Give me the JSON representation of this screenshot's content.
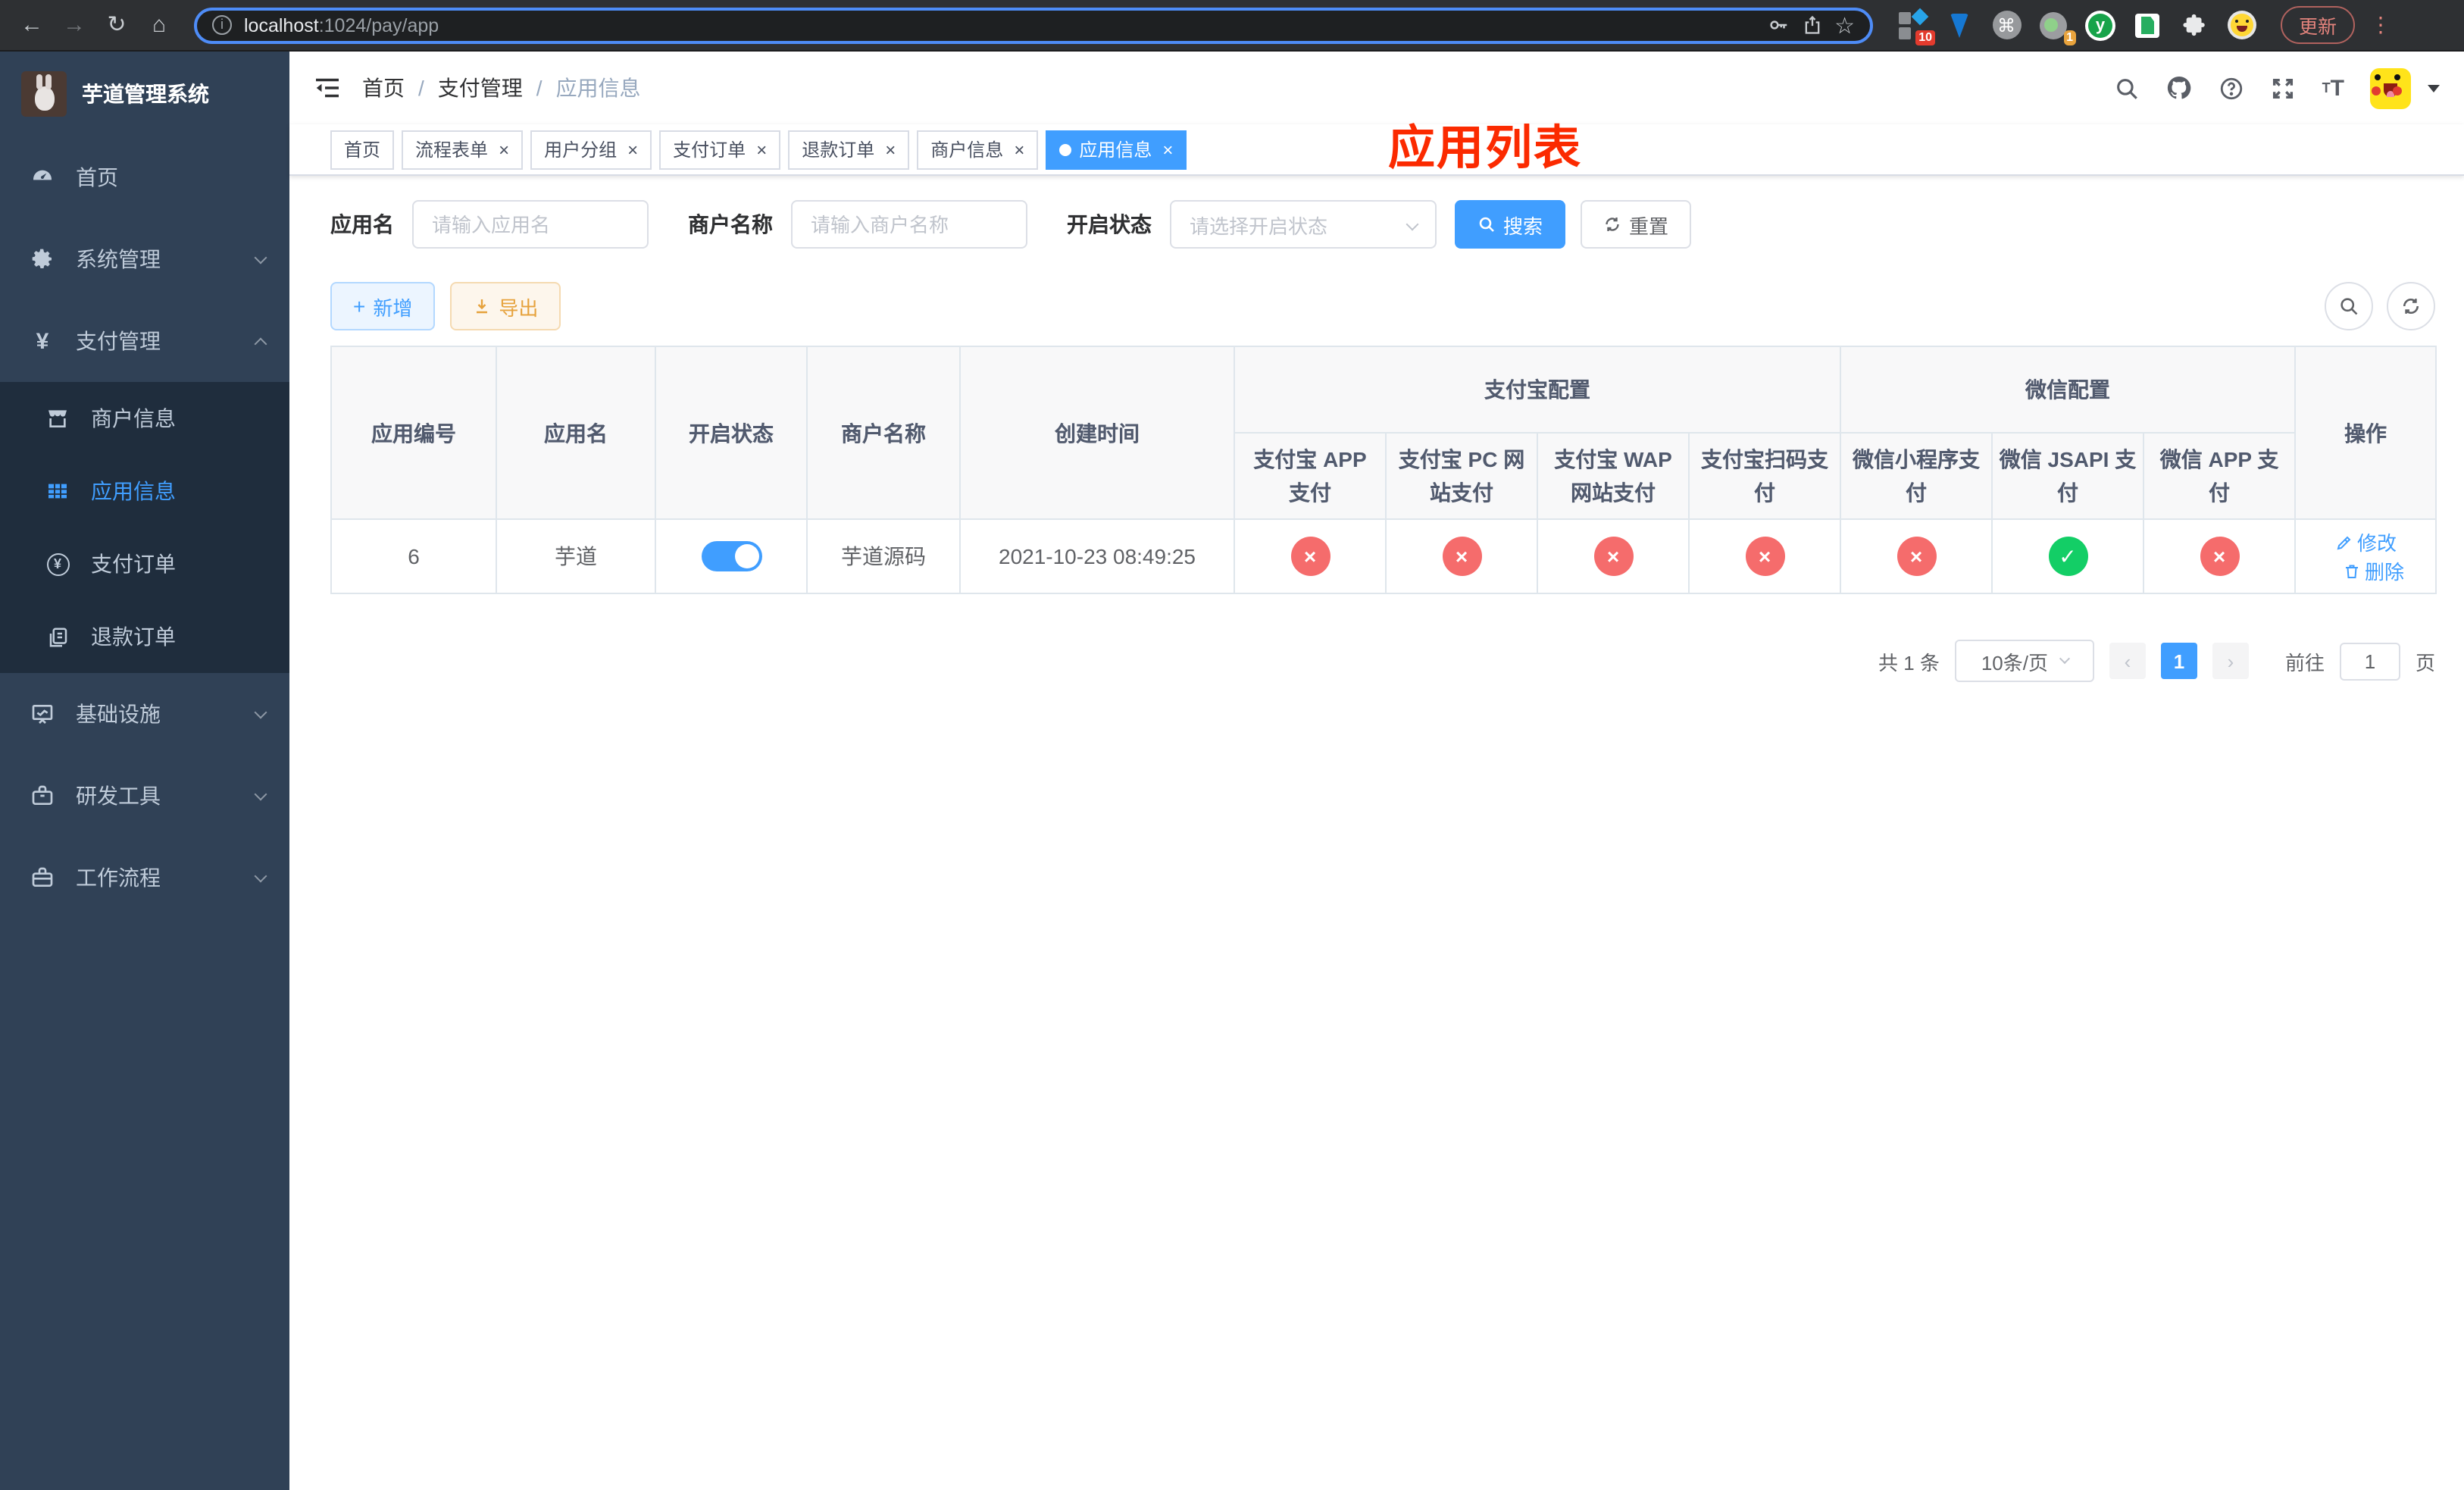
{
  "browser": {
    "url_host": "localhost",
    "url_rest": ":1024/pay/app",
    "update_label": "更新",
    "ext_badge_blocks": "10",
    "ext_badge_ring": "1",
    "ext_y_label": "y",
    "cmd_glyph": "⌘"
  },
  "sidebar": {
    "title": "芋道管理系统",
    "items": [
      {
        "label": "首页"
      },
      {
        "label": "系统管理"
      },
      {
        "label": "支付管理"
      },
      {
        "label": "商户信息"
      },
      {
        "label": "应用信息"
      },
      {
        "label": "支付订单"
      },
      {
        "label": "退款订单"
      },
      {
        "label": "基础设施"
      },
      {
        "label": "研发工具"
      },
      {
        "label": "工作流程"
      }
    ]
  },
  "header": {
    "breadcrumb": [
      "首页",
      "支付管理",
      "应用信息"
    ],
    "annotation": "应用列表"
  },
  "tabs": [
    {
      "label": "首页"
    },
    {
      "label": "流程表单"
    },
    {
      "label": "用户分组"
    },
    {
      "label": "支付订单"
    },
    {
      "label": "退款订单"
    },
    {
      "label": "商户信息"
    },
    {
      "label": "应用信息"
    }
  ],
  "search": {
    "fields": [
      {
        "label": "应用名",
        "placeholder": "请输入应用名"
      },
      {
        "label": "商户名称",
        "placeholder": "请输入商户名称"
      },
      {
        "label": "开启状态",
        "placeholder": "请选择开启状态"
      }
    ],
    "search_label": "搜索",
    "reset_label": "重置"
  },
  "toolbar": {
    "add_label": "新增",
    "export_label": "导出"
  },
  "table": {
    "groups": [
      {
        "label": "支付宝配置"
      },
      {
        "label": "微信配置"
      }
    ],
    "columns": [
      "应用编号",
      "应用名",
      "开启状态",
      "商户名称",
      "创建时间",
      "支付宝 APP 支付",
      "支付宝 PC 网站支付",
      "支付宝 WAP 网站支付",
      "支付宝扫码支付",
      "微信小程序支付",
      "微信 JSAPI 支付",
      "微信 APP 支付",
      "操作"
    ],
    "row": {
      "app_id": "6",
      "app_name": "芋道",
      "status_on": true,
      "merchant": "芋道源码",
      "created_at": "2021-10-23 08:49:25",
      "pay_channels": [
        "cross",
        "cross",
        "cross",
        "cross",
        "cross",
        "check",
        "cross"
      ],
      "edit_label": "修改",
      "delete_label": "删除"
    }
  },
  "pagination": {
    "total_label": "共 1 条",
    "page_size": "10条/页",
    "current_page": "1",
    "prev_glyph": "‹",
    "next_glyph": "›",
    "goto_label": "前往",
    "goto_value": "1",
    "page_label": "页"
  },
  "colors": {
    "accent": "#409eff",
    "danger": "#f56c6c",
    "success": "#13ce66",
    "annotation_red": "#fb2a00",
    "sidebar_bg": "#304156",
    "submenu_bg": "#1f2d3d"
  }
}
